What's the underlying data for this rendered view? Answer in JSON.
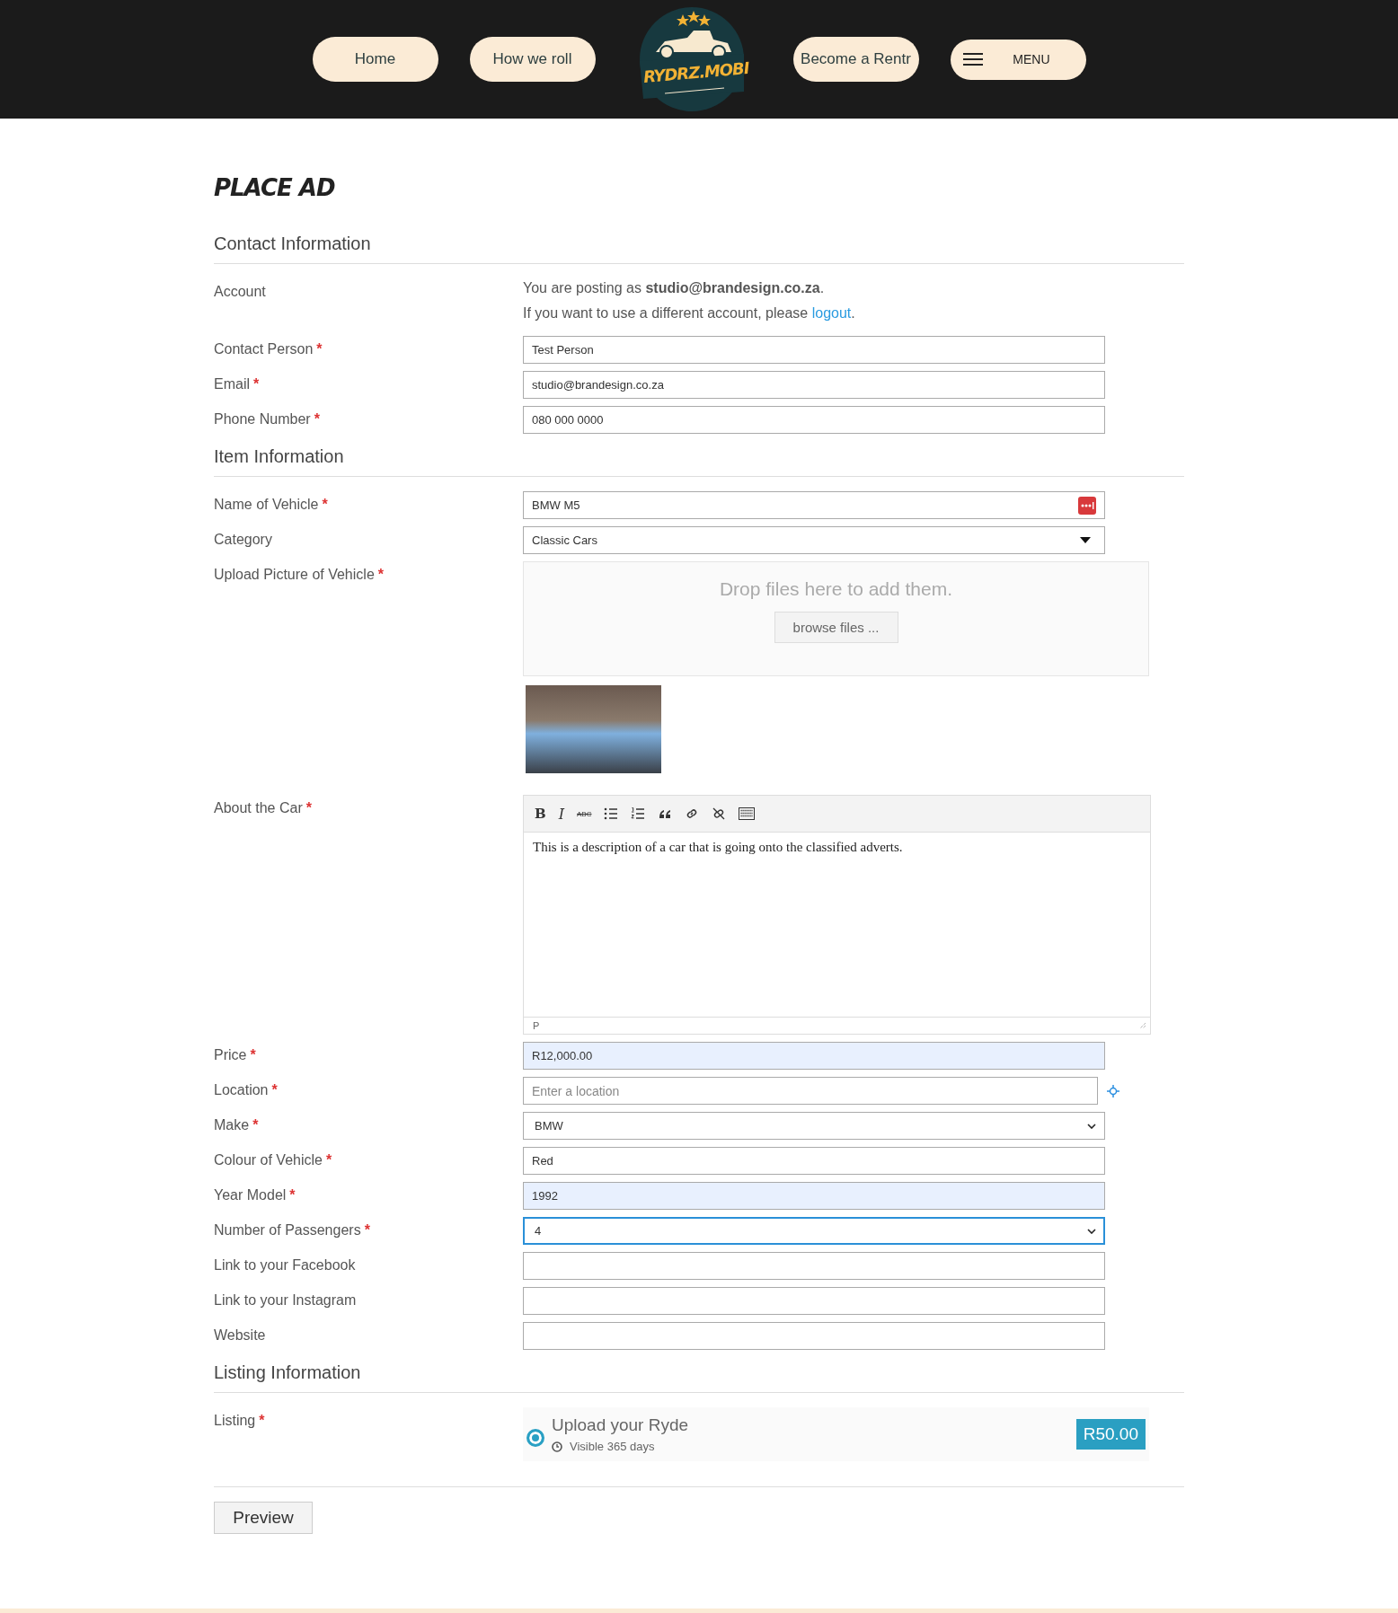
{
  "nav": {
    "left": [
      {
        "label": "Home"
      },
      {
        "label": "How we roll"
      }
    ],
    "logo": {
      "text": "RYDRZ.MOBI"
    },
    "right": [
      {
        "label": "Become a Rentr",
        "kind": "link"
      },
      {
        "label": "MENU",
        "kind": "menu"
      }
    ]
  },
  "title": "PLACE AD",
  "required_mark": "*",
  "sections": [
    {
      "heading": "Contact Information",
      "fields": [
        {
          "kind": "account",
          "label": "Account",
          "line1": "You are posting as **studio@brandesign.co.za**.",
          "line2_before": "If you want to use a different account, please ",
          "line2_link": "logout",
          "line2_after": "."
        },
        {
          "kind": "text",
          "label": "Contact Person",
          "required": true,
          "value": "Test Person",
          "highlighted": false,
          "focused": false
        },
        {
          "kind": "text",
          "label": "Email",
          "required": true,
          "value": "studio@brandesign.co.za",
          "highlighted": false,
          "focused": false
        },
        {
          "kind": "text",
          "label": "Phone Number",
          "required": true,
          "value": "080 000 0000",
          "highlighted": false,
          "focused": false
        }
      ]
    },
    {
      "heading": "Item Information",
      "fields": [
        {
          "kind": "text",
          "label": "Name of Vehicle",
          "required": true,
          "value": "BMW M5",
          "highlighted": false,
          "focused": false,
          "password_badge": true
        },
        {
          "kind": "combo",
          "label": "Category",
          "value": "Classic Cars"
        },
        {
          "kind": "upload",
          "label": "Upload Picture of Vehicle",
          "required": true,
          "drop_text": "Drop files here to add them.",
          "button": "browse files ..."
        },
        {
          "kind": "editor",
          "label": "About the Car",
          "required": true,
          "toolbar": [
            {
              "kind": "bold",
              "text": "B"
            },
            {
              "kind": "italic",
              "text": "I"
            },
            {
              "kind": "strike",
              "text": "ABC"
            },
            {
              "kind": "bullets"
            },
            {
              "kind": "numbers"
            },
            {
              "kind": "quote"
            },
            {
              "kind": "link"
            },
            {
              "kind": "unlink"
            },
            {
              "kind": "keyboard"
            }
          ],
          "body": "This is a description of a car that is going onto the classified adverts.",
          "path": "P"
        },
        {
          "kind": "text",
          "label": "Price",
          "required": true,
          "value": "R12,000.00",
          "highlighted": true,
          "focused": false
        },
        {
          "kind": "location",
          "label": "Location",
          "required": true,
          "placeholder": "Enter a location"
        },
        {
          "kind": "select",
          "label": "Make",
          "required": true,
          "value": "BMW",
          "focused": false
        },
        {
          "kind": "text",
          "label": "Colour of Vehicle",
          "required": true,
          "value": "Red",
          "highlighted": false,
          "focused": false
        },
        {
          "kind": "text",
          "label": "Year Model",
          "required": true,
          "value": "1992",
          "highlighted": true,
          "focused": false
        },
        {
          "kind": "select",
          "label": "Number of Passengers",
          "required": true,
          "value": "4",
          "focused": true
        },
        {
          "kind": "text",
          "label": "Link to your Facebook",
          "highlighted": false,
          "focused": false
        },
        {
          "kind": "text",
          "label": "Link to your Instagram",
          "highlighted": false,
          "focused": false
        },
        {
          "kind": "text",
          "label": "Website",
          "highlighted": false,
          "focused": false
        }
      ]
    },
    {
      "heading": "Listing Information",
      "fields": [
        {
          "kind": "listing",
          "label": "Listing",
          "required": true,
          "options": [
            {
              "title": "Upload your Ryde",
              "duration": "Visible 365 days",
              "price": "R50.00",
              "selected": true
            }
          ]
        }
      ]
    }
  ],
  "submit": "Preview"
}
